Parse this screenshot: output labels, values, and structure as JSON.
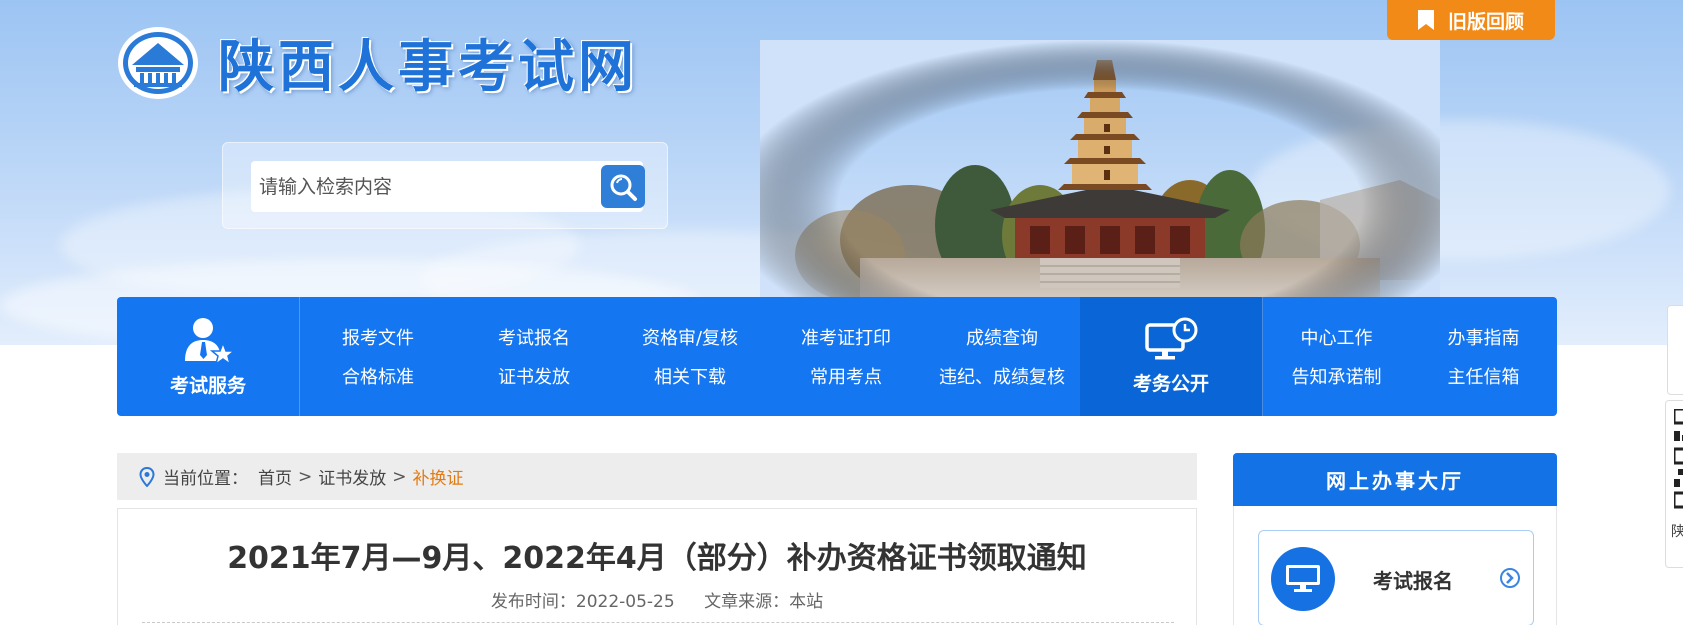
{
  "header": {
    "site_title": "陕西人事考试网",
    "old_version_label": "旧版回顾",
    "search": {
      "placeholder": "请输入检索内容"
    }
  },
  "nav": {
    "exam_service_label": "考试服务",
    "exam_public_label": "考务公开",
    "group1": [
      "报考文件",
      "考试报名",
      "资格审/复核",
      "准考证打印",
      "成绩查询",
      "合格标准",
      "证书发放",
      "相关下载",
      "常用考点",
      "违纪、成绩复核"
    ],
    "group2": [
      "中心工作",
      "办事指南",
      "告知承诺制",
      "主任信箱"
    ]
  },
  "breadcrumb": {
    "prefix": "当前位置：",
    "home": "首页",
    "section": "证书发放",
    "current": "补换证",
    "sep1": ">",
    "sep2": ">"
  },
  "article": {
    "title": "2021年7月—9月、2022年4月（部分）补办资格证书领取通知",
    "publish_time": "发布时间：2022-05-25",
    "source": "文章来源：本站"
  },
  "sidebar": {
    "heading": "网上办事大厅",
    "card_label": "考试报名"
  },
  "float": {
    "qr_text": "陕"
  },
  "colors": {
    "nav_blue": "#1476f0",
    "accent_orange": "#f28a18",
    "breadcrumb_current": "#e17b18",
    "sidebar_blue": "#1272e6"
  },
  "icons": [
    "emblem-logo",
    "bookmark-icon",
    "search-icon",
    "user-star-icon",
    "monitor-clock-icon",
    "location-pin-icon",
    "monitor-icon",
    "arrow-circle-right-icon",
    "qr-code-icon"
  ]
}
